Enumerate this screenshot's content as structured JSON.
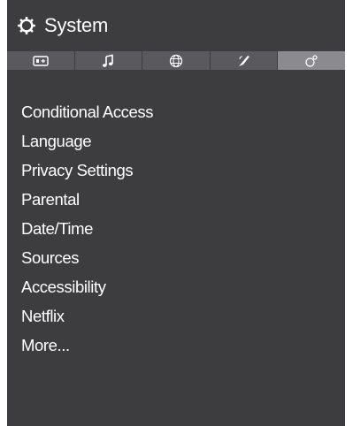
{
  "header": {
    "title": "System",
    "icon": "gear-icon"
  },
  "tabs": [
    {
      "icon": "picture-icon",
      "active": false
    },
    {
      "icon": "music-note-icon",
      "active": false
    },
    {
      "icon": "network-globe-icon",
      "active": false
    },
    {
      "icon": "satellite-dish-icon",
      "active": false
    },
    {
      "icon": "system-settings-icon",
      "active": true
    }
  ],
  "menu": {
    "items": [
      "Conditional Access",
      "Language",
      "Privacy Settings",
      "Parental",
      "Date/Time",
      "Sources",
      "Accessibility",
      "Netflix",
      "More..."
    ]
  },
  "colors": {
    "panel_background": "#3d3c3f",
    "tab_background": "#5a595d",
    "tab_active_background": "#8b8a8f",
    "text": "#ffffff"
  }
}
